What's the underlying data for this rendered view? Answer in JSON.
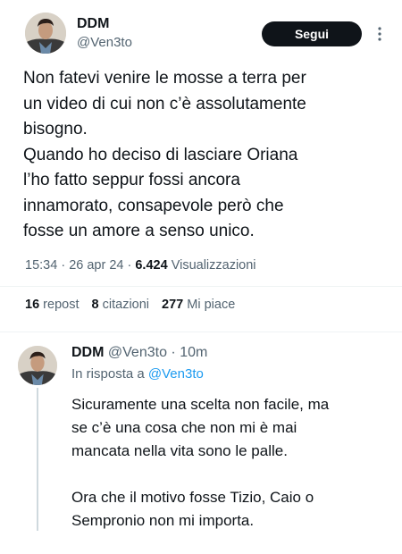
{
  "tweet": {
    "author_name": "DDM",
    "author_handle": "@Ven3to",
    "follow_label": "Segui",
    "more_icon": "more-vertical-icon",
    "text_lines": [
      "Non fatevi venire le mosse a terra per",
      "un video di cui non c’è assolutamente",
      "bisogno.",
      "Quando ho deciso di lasciare Oriana",
      "l’ho fatto seppur fossi ancora",
      "innamorato, consapevole però che",
      "fosse un amore a senso unico."
    ],
    "time": "15:34",
    "date": "26 apr 24",
    "views_count": "6.424",
    "views_label": "Visualizzazioni",
    "reposts_count": "16",
    "reposts_label": "repost",
    "quotes_count": "8",
    "quotes_label": "citazioni",
    "likes_count": "277",
    "likes_label": "Mi piace"
  },
  "reply": {
    "author_name": "DDM",
    "author_handle": "@Ven3to",
    "age": "10m",
    "in_reply_prefix": "In risposta a",
    "in_reply_handle": "@Ven3to",
    "paragraph1": [
      "Sicuramente una scelta non facile, ma",
      "se c’è una cosa che non mi è mai",
      "mancata nella vita sono le palle."
    ],
    "paragraph2": [
      "Ora che il motivo fosse Tizio, Caio o",
      "Sempronio non mi importa."
    ]
  },
  "colors": {
    "text": "#0f1419",
    "secondary": "#536471",
    "link": "#1d9bf0",
    "button_bg": "#0f1419",
    "divider": "#eff3f4"
  }
}
